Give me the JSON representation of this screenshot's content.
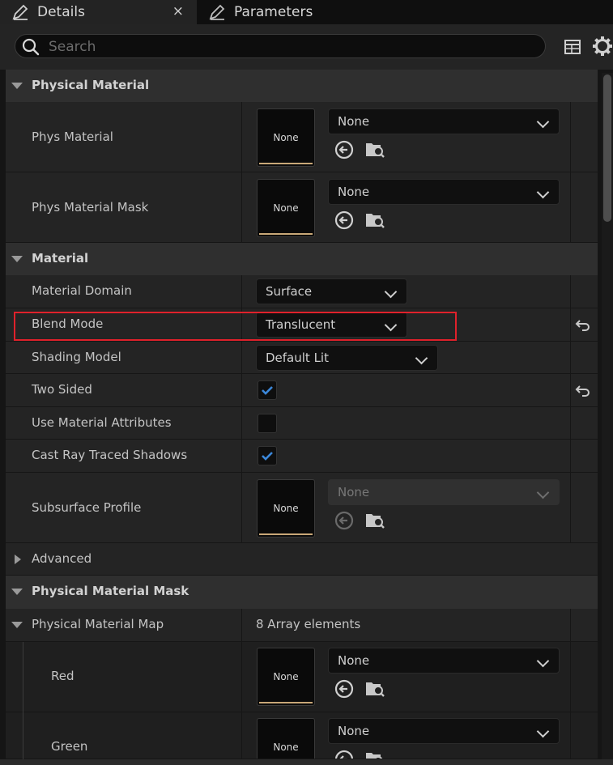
{
  "tabs": [
    {
      "label": "Details",
      "icon": "pencil-icon",
      "active": true,
      "close": "×"
    },
    {
      "label": "Parameters",
      "icon": "pencil-icon",
      "active": false
    }
  ],
  "search": {
    "placeholder": "Search",
    "value": ""
  },
  "toolbar": {
    "view_options_icon": "table-icon",
    "settings_icon": "gear-icon"
  },
  "sections": {
    "physical_material": {
      "title": "Physical Material",
      "phys_material": {
        "label": "Phys Material",
        "thumb": "None",
        "value": "None"
      },
      "phys_material_mask": {
        "label": "Phys Material Mask",
        "thumb": "None",
        "value": "None"
      }
    },
    "material": {
      "title": "Material",
      "material_domain": {
        "label": "Material Domain",
        "value": "Surface"
      },
      "blend_mode": {
        "label": "Blend Mode",
        "value": "Translucent",
        "modified": true
      },
      "shading_model": {
        "label": "Shading Model",
        "value": "Default Lit"
      },
      "two_sided": {
        "label": "Two Sided",
        "checked": true,
        "modified": true
      },
      "use_material_attributes": {
        "label": "Use Material Attributes",
        "checked": false
      },
      "cast_ray_traced_shadows": {
        "label": "Cast Ray Traced Shadows",
        "checked": true
      },
      "subsurface_profile": {
        "label": "Subsurface Profile",
        "thumb": "None",
        "value": "None",
        "disabled": true
      },
      "advanced": {
        "label": "Advanced"
      }
    },
    "physical_material_mask": {
      "title": "Physical Material Mask",
      "physical_material_map": {
        "label": "Physical Material Map",
        "value": "8 Array elements"
      },
      "red": {
        "label": "Red",
        "thumb": "None",
        "value": "None"
      },
      "green": {
        "label": "Green",
        "thumb": "None",
        "value": "None"
      }
    }
  },
  "colors": {
    "highlight": "#e0212b",
    "accent_checkmark": "#3b87d9",
    "thumb_bar": "#c9a878"
  }
}
